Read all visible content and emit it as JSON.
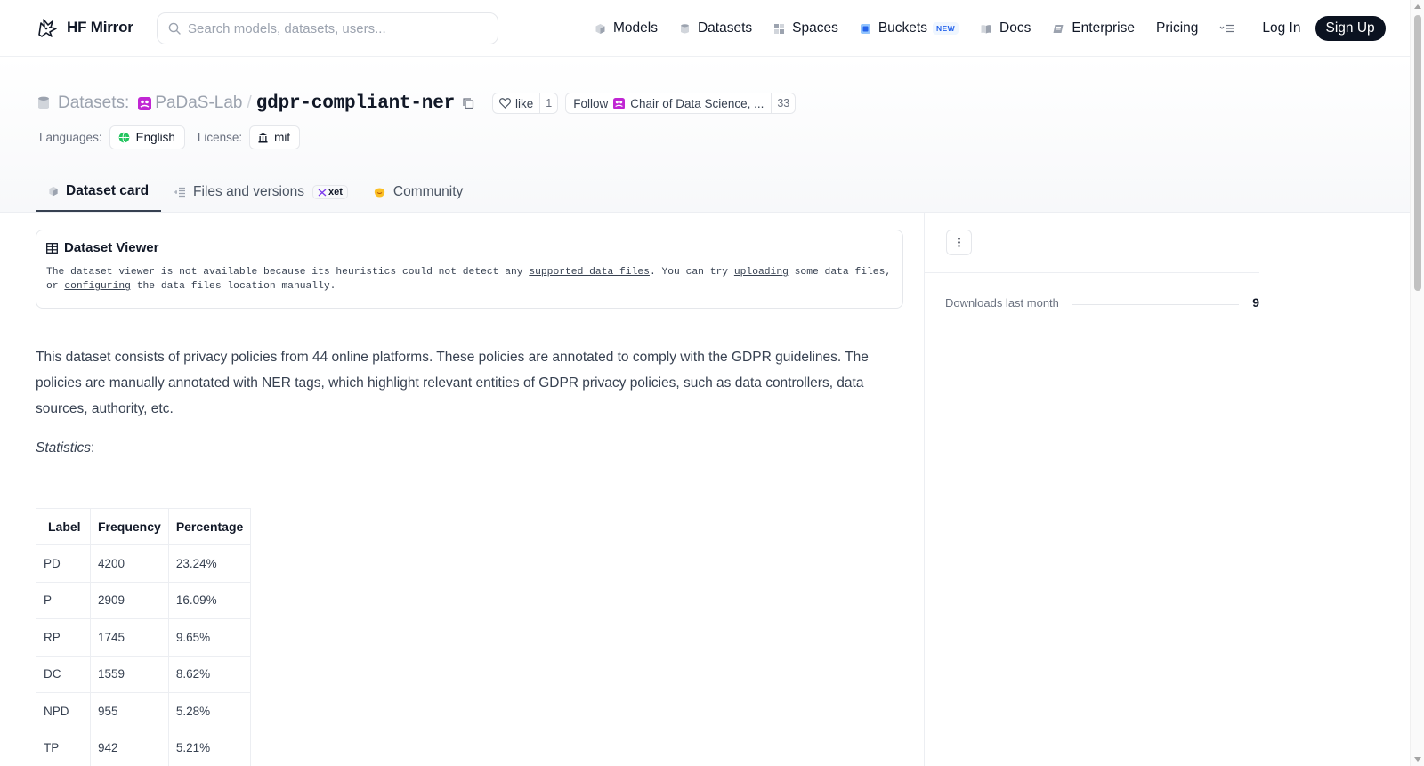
{
  "app": {
    "brand": "HF Mirror"
  },
  "search": {
    "placeholder": "Search models, datasets, users..."
  },
  "nav": {
    "items": [
      {
        "label": "Models",
        "icon": "cube-icon"
      },
      {
        "label": "Datasets",
        "icon": "database-icon"
      },
      {
        "label": "Spaces",
        "icon": "grid-icon"
      },
      {
        "label": "Buckets",
        "icon": "bucket-icon",
        "badge": "NEW"
      },
      {
        "label": "Docs",
        "icon": "book-icon"
      },
      {
        "label": "Enterprise",
        "icon": "enterprise-icon"
      },
      {
        "label": "Pricing"
      }
    ],
    "login": "Log In",
    "signup": "Sign Up"
  },
  "repo": {
    "type_label": "Datasets:",
    "org": "PaDaS-Lab",
    "separator": "/",
    "name": "gdpr-compliant-ner",
    "like_label": "like",
    "like_count": "1",
    "follow_label": "Follow",
    "follow_org": "Chair of Data Science, ...",
    "follow_count": "33"
  },
  "meta": {
    "languages_label": "Languages:",
    "language": "English",
    "license_label": "License:",
    "license": "mit"
  },
  "tabs": [
    {
      "label": "Dataset card",
      "active": true
    },
    {
      "label": "Files and versions",
      "badge": "xet"
    },
    {
      "label": "Community"
    }
  ],
  "viewer": {
    "title": "Dataset Viewer",
    "text_1": "The dataset viewer is not available because its heuristics could not detect any ",
    "link_1": "supported data files",
    "text_2": ". You can try ",
    "link_2": "uploading",
    "text_3": " some data files, or ",
    "link_3": "configuring",
    "text_4": " the data files location manually."
  },
  "card": {
    "description": "This dataset consists of privacy policies from 44 online platforms. These policies are annotated to comply with the GDPR guidelines. The policies are manually annotated with NER tags, which highlight relevant entities of GDPR privacy policies, such as data controllers, data sources, authority, etc.",
    "statistics_label": "Statistics",
    "statistics_colon": ":",
    "table": {
      "headers": [
        "Label",
        "Frequency",
        "Percentage"
      ],
      "rows": [
        [
          "PD",
          "4200",
          "23.24%"
        ],
        [
          "P",
          "2909",
          "16.09%"
        ],
        [
          "RP",
          "1745",
          "9.65%"
        ],
        [
          "DC",
          "1559",
          "8.62%"
        ],
        [
          "NPD",
          "955",
          "5.28%"
        ],
        [
          "TP",
          "942",
          "5.21%"
        ]
      ]
    }
  },
  "sidebar": {
    "downloads_label": "Downloads last month",
    "downloads_value": "9"
  },
  "colors": {
    "signup_bg": "#0b1220",
    "border": "#e5e7eb",
    "muted_text": "#9ca3af",
    "new_badge": "#2563eb"
  }
}
